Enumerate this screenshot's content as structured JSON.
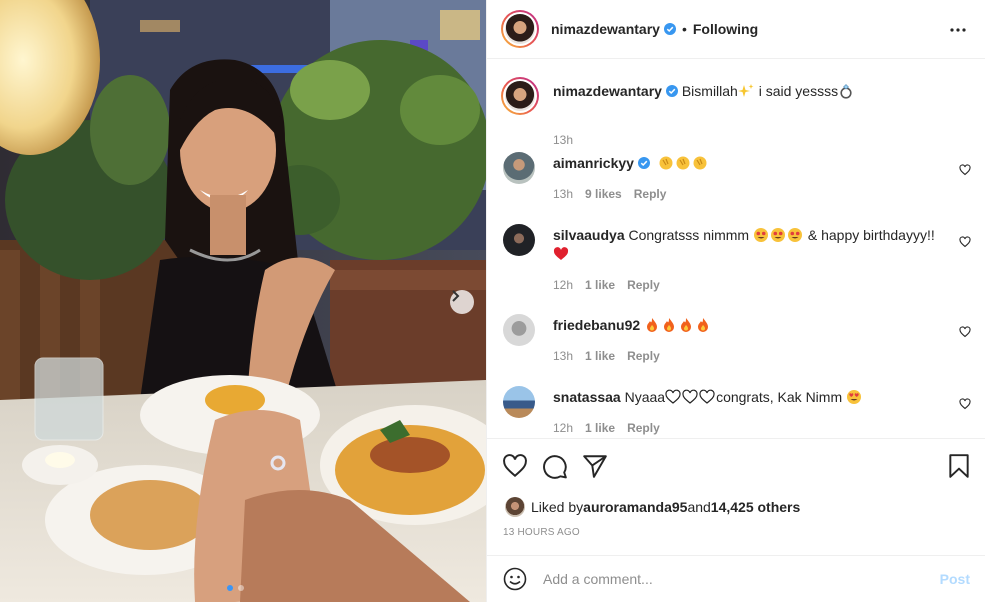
{
  "post": {
    "author": "nimazdewantary",
    "header_bullet": "•",
    "follow_status": "Following",
    "caption_text_1": "Bismillah",
    "caption_text_2": " i said yessss",
    "caption_time": "13h"
  },
  "comments": [
    {
      "user": "aimanrickyy",
      "verified": true,
      "text": "",
      "time": "13h",
      "likes": "9 likes",
      "reply": "Reply"
    },
    {
      "user": "silvaaudya",
      "text": "Congratsss nimmm",
      "text_2": "& happy birthdayyy!!",
      "time": "12h",
      "likes": "1 like",
      "reply": "Reply"
    },
    {
      "user": "friedebanu92",
      "text": "",
      "time": "13h",
      "likes": "1 like",
      "reply": "Reply"
    },
    {
      "user": "snatassaa",
      "text": "Nyaaa",
      "text_2": "congrats, Kak Nimm",
      "time": "12h",
      "likes": "1 like",
      "reply": "Reply"
    }
  ],
  "likes_bar": {
    "prefix": "Liked by ",
    "user": "auroramanda95",
    "middle": " and ",
    "others": "14,425 others"
  },
  "timestamp": "13 HOURS AGO",
  "add_comment": {
    "placeholder": "Add a comment...",
    "post_label": "Post"
  },
  "icons": {
    "more": "more-dots-icon",
    "like": "heart-icon",
    "comment": "comment-bubble-icon",
    "share": "paper-plane-icon",
    "save": "bookmark-icon",
    "emoji": "smiley-icon",
    "next": "chevron-right-icon"
  },
  "colors": {
    "verified": "#3897f0",
    "link": "#b3dbff",
    "meta": "#8e8e8e",
    "active_dot": "#3b95f5"
  },
  "carousel": {
    "current": 1,
    "total": 2
  }
}
